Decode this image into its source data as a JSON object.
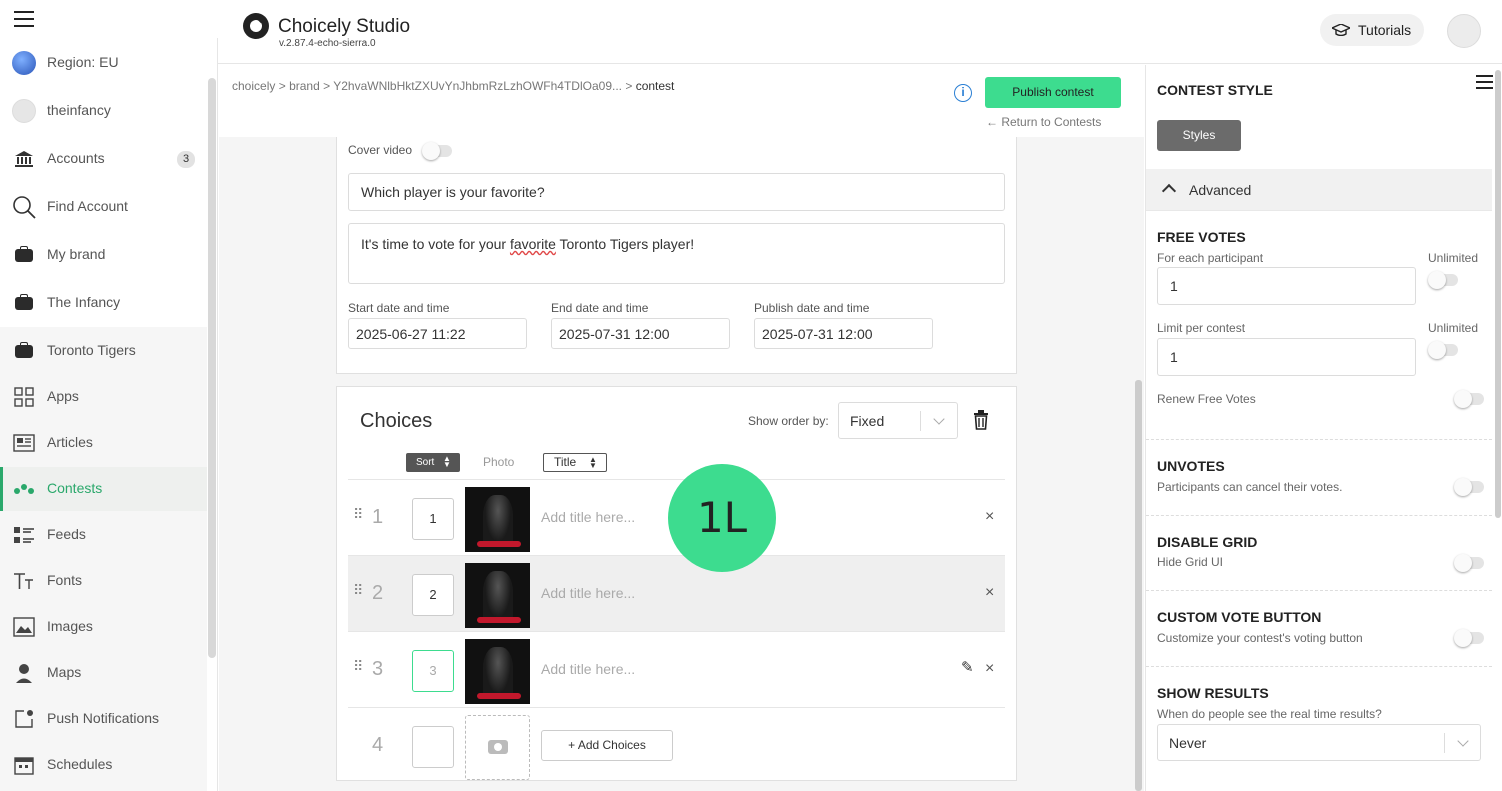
{
  "header": {
    "app_title": "Choicely Studio",
    "version": "v.2.87.4-echo-sierra.0",
    "tutorials_label": "Tutorials"
  },
  "sidebar": {
    "items": [
      {
        "label": "Region: EU",
        "icon": "globe-icon"
      },
      {
        "label": "theinfancy",
        "icon": "user-avatar-icon"
      },
      {
        "label": "Accounts",
        "icon": "bank-icon",
        "badge": "3"
      },
      {
        "label": "Find Account",
        "icon": "search-icon"
      },
      {
        "label": "My brand",
        "icon": "briefcase-icon"
      },
      {
        "label": "The Infancy",
        "icon": "briefcase-icon"
      },
      {
        "label": "Toronto Tigers",
        "icon": "briefcase-icon"
      },
      {
        "label": "Apps",
        "icon": "apps-grid-icon"
      },
      {
        "label": "Articles",
        "icon": "article-icon"
      },
      {
        "label": "Contests",
        "icon": "contest-icon",
        "active": true
      },
      {
        "label": "Feeds",
        "icon": "feed-icon"
      },
      {
        "label": "Fonts",
        "icon": "font-icon"
      },
      {
        "label": "Images",
        "icon": "image-icon"
      },
      {
        "label": "Maps",
        "icon": "map-pin-icon"
      },
      {
        "label": "Push Notifications",
        "icon": "notification-icon"
      },
      {
        "label": "Schedules",
        "icon": "calendar-icon"
      }
    ]
  },
  "breadcrumb": {
    "items": [
      "choicely",
      "brand",
      "Y2hvaWNlbHktZXUvYnJhbmRzLzhOWFh4TDlOa09...",
      "contest"
    ],
    "sep": ">"
  },
  "actions": {
    "publish_label": "Publish contest",
    "return_label": "Return to Contests"
  },
  "contest": {
    "cover_video_label": "Cover video",
    "question": "Which player is your favorite?",
    "description_pre": "It's time to vote for your ",
    "description_flagged": "favorite",
    "description_post": " Toronto Tigers player!",
    "start_label": "Start date and time",
    "start_value": "2025-06-27 11:22",
    "end_label": "End date and time",
    "end_value": "2025-07-31 12:00",
    "publish_label": "Publish date and time",
    "publish_value": "2025-07-31 12:00"
  },
  "choices": {
    "title": "Choices",
    "show_order_label": "Show order by:",
    "show_order_value": "Fixed",
    "col_sort": "Sort",
    "col_photo": "Photo",
    "col_title": "Title",
    "title_placeholder": "Add title here...",
    "rows": [
      {
        "num": "1",
        "sort": "1"
      },
      {
        "num": "2",
        "sort": "2"
      },
      {
        "num": "3",
        "sort": "3"
      }
    ],
    "new_row_num": "4",
    "add_label": "+ Add Choices"
  },
  "overlay_badge": "1L",
  "right_panel": {
    "title": "CONTEST STYLE",
    "styles_label": "Styles",
    "advanced_label": "Advanced",
    "free_votes": {
      "title": "FREE VOTES",
      "per_participant_label": "For each participant",
      "per_participant_value": "1",
      "limit_label": "Limit per contest",
      "limit_value": "1",
      "unlimited_label": "Unlimited",
      "renew_label": "Renew Free Votes"
    },
    "unvotes": {
      "title": "UNVOTES",
      "desc": "Participants can cancel their votes."
    },
    "disable_grid": {
      "title": "DISABLE GRID",
      "desc": "Hide Grid UI"
    },
    "custom_vote": {
      "title": "CUSTOM VOTE BUTTON",
      "desc": "Customize your contest's voting button"
    },
    "show_results": {
      "title": "SHOW RESULTS",
      "desc": "When do people see the real time results?",
      "value": "Never"
    }
  },
  "colors": {
    "accent": "#3ddc8f",
    "active_nav": "#2aa86b"
  }
}
